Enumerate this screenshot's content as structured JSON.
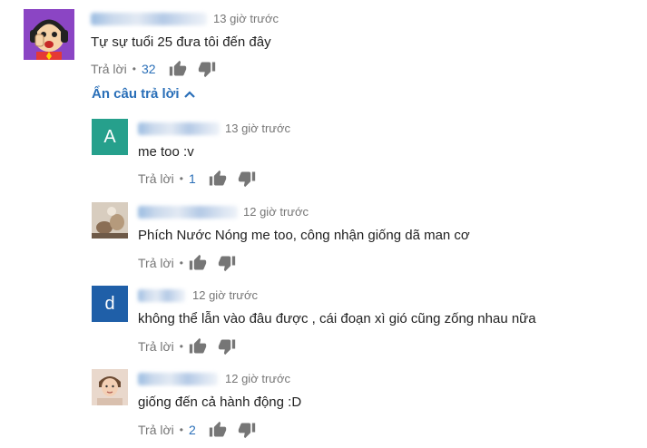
{
  "colors": {
    "link": "#2a6fb8",
    "meta": "#767676",
    "avatar_a": "#26a08c",
    "avatar_d": "#1f5fa8"
  },
  "top_comment": {
    "time": "13 giờ trước",
    "text": "Tự sự tuổi 25 đưa tôi đến đây",
    "reply_label": "Trả lời",
    "likes": "32"
  },
  "hide_replies_label": "Ẩn câu trả lời",
  "replies": [
    {
      "avatar_letter": "A",
      "time": "13 giờ trước",
      "text": "me too :v",
      "reply_label": "Trả lời",
      "likes": "1"
    },
    {
      "avatar_letter": "",
      "time": "12 giờ trước",
      "text": "Phích Nước Nóng  me too, công nhận giống dã man cơ",
      "reply_label": "Trả lời",
      "likes": ""
    },
    {
      "avatar_letter": "d",
      "time": "12 giờ trước",
      "text": "không thể lẫn vào đâu được , cái đoạn xì gió cũng zống nhau nữa",
      "reply_label": "Trả lời",
      "likes": ""
    },
    {
      "avatar_letter": "",
      "time": "12 giờ trước",
      "text": "giống đến cả hành động :D",
      "reply_label": "Trả lời",
      "likes": "2"
    }
  ]
}
